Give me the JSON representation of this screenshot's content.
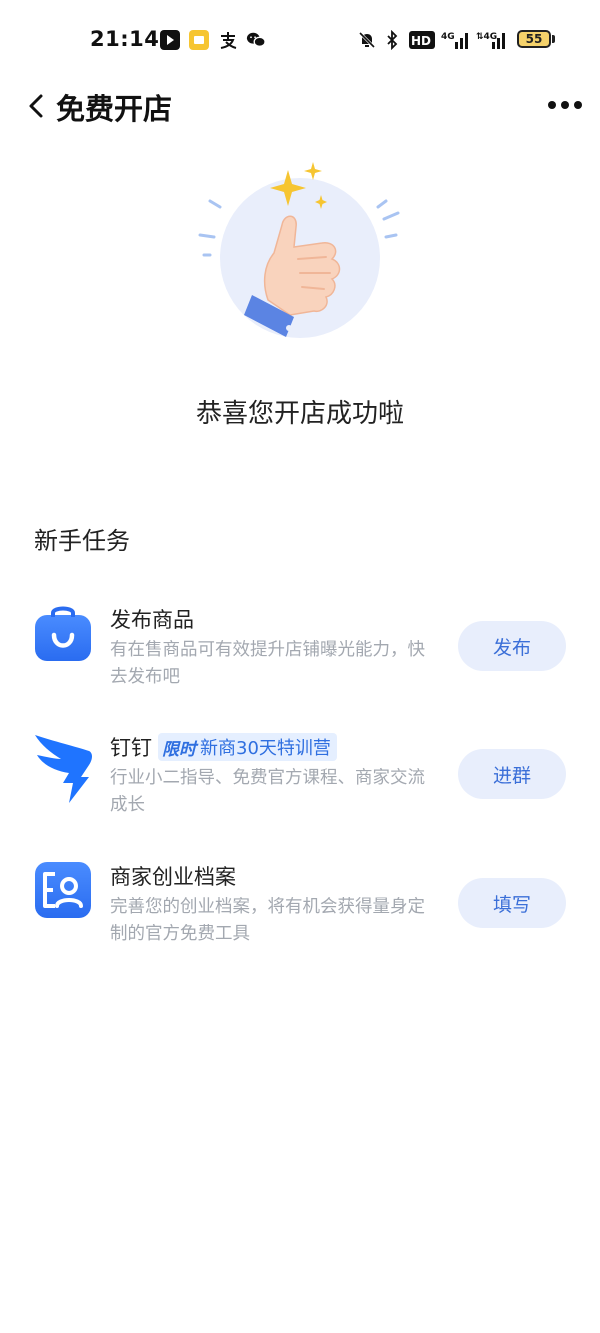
{
  "status_bar": {
    "time": "21:14",
    "battery": "55"
  },
  "header": {
    "title": "免费开店"
  },
  "hero": {
    "message": "恭喜您开店成功啦"
  },
  "tasks_section": {
    "title": "新手任务"
  },
  "tasks": [
    {
      "title": "发布商品",
      "description": "有在售商品可有效提升店铺曝光能力，快去发布吧",
      "button": "发布",
      "icon": "shopping-bag-icon"
    },
    {
      "title": "钉钉",
      "tag_label": "限时",
      "tag_text": "新商30天特训营",
      "description": "行业小二指导、免费官方课程、商家交流成长",
      "button": "进群",
      "icon": "dingtalk-icon"
    },
    {
      "title": "商家创业档案",
      "description": "完善您的创业档案，将有机会获得量身定制的官方免费工具",
      "button": "填写",
      "icon": "profile-card-icon"
    }
  ],
  "colors": {
    "accent": "#3b6fd8",
    "button_bg": "#e8eefc",
    "muted_text": "#a3a8b0"
  }
}
